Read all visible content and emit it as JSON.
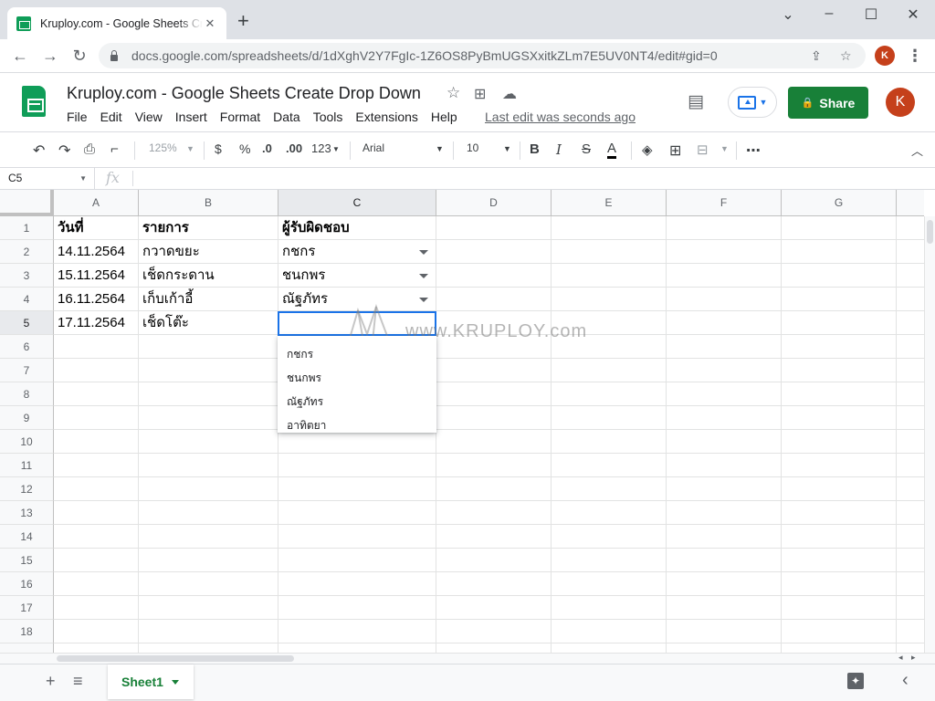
{
  "browser": {
    "tab_title": "Kruploy.com - Google Sheets Create Drop Down",
    "tab_close": "✕",
    "new_tab": "+",
    "window_controls": {
      "minimize": "⌄",
      "restore": "–",
      "maximize": "☐",
      "close": "✕"
    },
    "url": "docs.google.com/spreadsheets/d/1dXghV2Y7FgIc-1Z6OS8PyBmUGSXxitkZLm7E5UV0NT4/edit#gid=0",
    "nav": {
      "back": "←",
      "forward": "→",
      "reload": "↻"
    },
    "profile_initial": "K",
    "menu": "⋮"
  },
  "app": {
    "doc_title": "Kruploy.com - Google Sheets Create Drop Down",
    "menu": [
      "File",
      "Edit",
      "View",
      "Insert",
      "Format",
      "Data",
      "Tools",
      "Extensions",
      "Help"
    ],
    "last_edit": "Last edit was seconds ago",
    "share_label": "Share",
    "user_initial": "K"
  },
  "toolbar": {
    "zoom": "125%",
    "currency": "$",
    "percent": "%",
    "decimal_decrease": ".0",
    "decimal_increase": ".00",
    "more_formats": "123",
    "font": "Arial",
    "font_size": "10",
    "bold": "B",
    "italic": "I",
    "strike": "S",
    "text_color": "A",
    "more": "⋯"
  },
  "formula_bar": {
    "name_box": "C5",
    "fx": "fx",
    "value": ""
  },
  "columns": [
    "A",
    "B",
    "C",
    "D",
    "E",
    "F",
    "G"
  ],
  "rows": [
    "1",
    "2",
    "3",
    "4",
    "5",
    "6",
    "7",
    "8",
    "9",
    "10",
    "11",
    "12",
    "13",
    "14",
    "15",
    "16",
    "17",
    "18"
  ],
  "cells": {
    "A1": "วันที่",
    "B1": "รายการ",
    "C1": "ผู้รับผิดชอบ",
    "A2": "14.11.2564",
    "B2": "กวาดขยะ",
    "C2": "กชกร",
    "A3": "15.11.2564",
    "B3": "เช็ดกระดาน",
    "C3": "ชนกพร",
    "A4": "16.11.2564",
    "B4": "เก็บเก้าอี้",
    "C4": "ณัฐภัทร",
    "A5": "17.11.2564",
    "B5": "เช็ดโต๊ะ",
    "C5": ""
  },
  "dropdown_options": [
    "กชกร",
    "ชนกพร",
    "ณัฐภัทร",
    "อาทิตยา"
  ],
  "watermark": "www.KRUPLOY.com",
  "sheet_tabs": {
    "add": "+",
    "all_sheets": "≡",
    "active": "Sheet1",
    "collapse": "‹"
  },
  "colors": {
    "accent": "#1a73e8",
    "share": "#188038",
    "avatar": "#c5401b"
  }
}
